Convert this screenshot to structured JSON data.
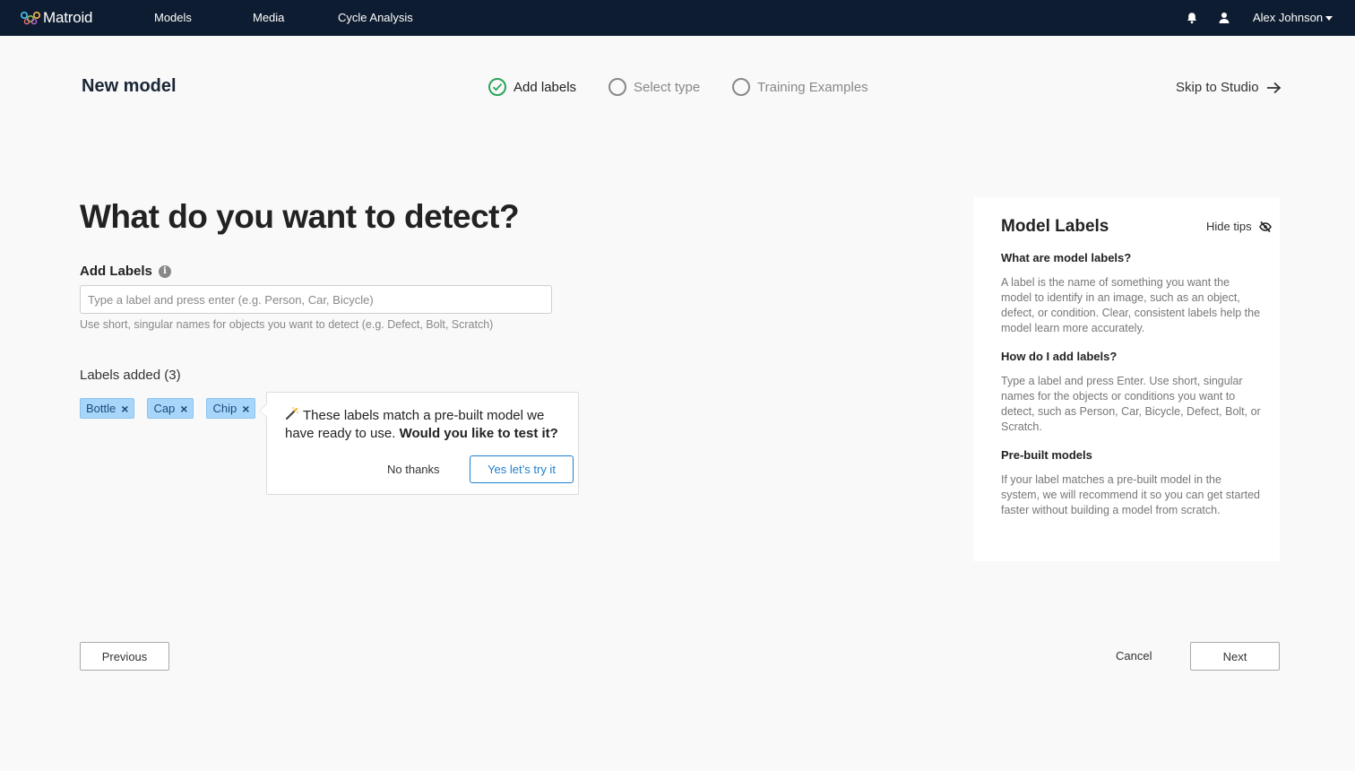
{
  "nav": {
    "brand": "Matroid",
    "links": [
      "Models",
      "Media",
      "Cycle Analysis"
    ],
    "user_name": "Alex Johnson",
    "icons": [
      "bell-icon",
      "user-icon",
      "caret-down-icon"
    ],
    "background": "#0d1c30"
  },
  "header": {
    "title": "New model",
    "steps": [
      {
        "label": "Add labels",
        "status": "complete"
      },
      {
        "label": "Select type",
        "status": "pending"
      },
      {
        "label": "Training Examples",
        "status": "pending"
      }
    ],
    "skip_label": "Skip to Studio"
  },
  "main": {
    "headline": "What do you want to detect?",
    "add_labels_title": "Add Labels",
    "input_placeholder": "Type a label and press enter (e.g. Person, Car, Bicycle)",
    "input_value": "",
    "help_text": "Use short, singular names for objects you want to detect (e.g. Defect, Bolt, Scratch)",
    "labels_added_title": "Labels added (3)",
    "labels": [
      "Bottle",
      "Cap",
      "Chip"
    ]
  },
  "popover": {
    "text": "These labels match a pre-built model we have ready to use.",
    "question": "Would you like to test it?",
    "no_label": "No thanks",
    "yes_label": "Yes let’s try it",
    "accent": "#1e7fd0"
  },
  "panel": {
    "title": "Model Labels",
    "hide_tips": "Hide tips",
    "sections": [
      {
        "heading": "What are model labels?",
        "body": "A label is the name of something you want the model to identify in an image, such as an object, defect, or condition. Clear, consistent labels help the model learn more accurately."
      },
      {
        "heading": "How do I add labels?",
        "body": "Type a label and press Enter. Use short, singular names for the objects or conditions you want to detect, such as Person, Car, Bicycle, Defect, Bolt, or Scratch."
      },
      {
        "heading": "Pre-built models",
        "body": "If your label matches a pre-built model in the system, we will recommend it so you can get started faster without building a model from scratch."
      }
    ]
  },
  "footer": {
    "previous": "Previous",
    "cancel": "Cancel",
    "next": "Next"
  },
  "colors": {
    "chip_bg": "#a8d6fb",
    "step_done": "#2aa55a"
  }
}
